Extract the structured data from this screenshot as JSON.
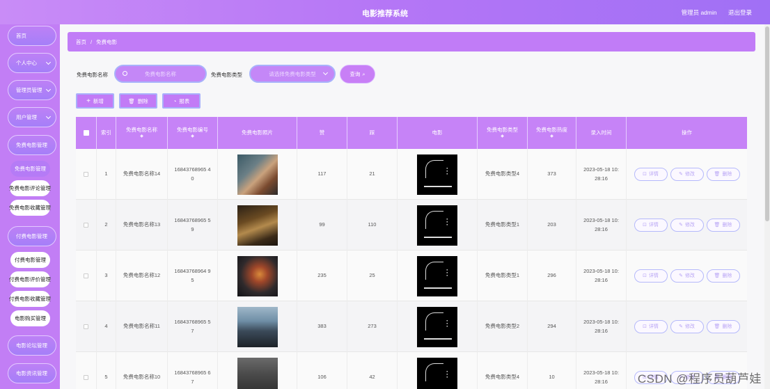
{
  "header": {
    "title": "电影推荐系统",
    "user_label": "管理员 admin",
    "logout": "退出登录"
  },
  "sidebar": {
    "items": [
      {
        "label": "首页"
      },
      {
        "label": "个人中心"
      },
      {
        "label": "管理员管理"
      },
      {
        "label": "用户管理"
      },
      {
        "label": "免费电影管理"
      },
      {
        "label": "免费电影管理"
      },
      {
        "label": "免费电影评论管理"
      },
      {
        "label": "免费电影收藏管理"
      },
      {
        "label": "付费电影管理"
      },
      {
        "label": "付费电影管理"
      },
      {
        "label": "付费电影评价管理"
      },
      {
        "label": "付费电影收藏管理"
      },
      {
        "label": "电影购买管理"
      },
      {
        "label": "电影论坛管理"
      },
      {
        "label": "电影资讯管理"
      }
    ]
  },
  "breadcrumb": {
    "home": "首页",
    "sep": "/",
    "current": "免费电影"
  },
  "search": {
    "name_label": "免费电影名称",
    "name_placeholder": "免费电影名称",
    "type_label": "免费电影类型",
    "type_placeholder": "请选择免费电影类型",
    "query": "查询"
  },
  "actions": {
    "add": "新增",
    "delete": "删除",
    "report": "报表"
  },
  "table": {
    "headers": [
      "索引",
      "免费电影名称",
      "免费电影编号",
      "免费电影照片",
      "赞",
      "踩",
      "电影",
      "免费电影类型",
      "免费电影热度",
      "录入时间",
      "操作"
    ],
    "ops": {
      "detail": "详情",
      "edit": "修改",
      "delete": "删除"
    },
    "rows": [
      {
        "index": "1",
        "name": "免费电影名称14",
        "code1": "16843768965 4",
        "code2": "0",
        "likes": "117",
        "dislikes": "21",
        "type": "免费电影类型4",
        "heat": "373",
        "date": "2023-05-18 10:",
        "time": "28:16"
      },
      {
        "index": "2",
        "name": "免费电影名称13",
        "code1": "16843768965 5",
        "code2": "9",
        "likes": "99",
        "dislikes": "110",
        "type": "免费电影类型1",
        "heat": "203",
        "date": "2023-05-18 10:",
        "time": "28:16"
      },
      {
        "index": "3",
        "name": "免费电影名称12",
        "code1": "16843768964 9",
        "code2": "5",
        "likes": "235",
        "dislikes": "25",
        "type": "免费电影类型1",
        "heat": "296",
        "date": "2023-05-18 10:",
        "time": "28:16"
      },
      {
        "index": "4",
        "name": "免费电影名称11",
        "code1": "16843768965 5",
        "code2": "7",
        "likes": "383",
        "dislikes": "273",
        "type": "免费电影类型2",
        "heat": "294",
        "date": "2023-05-18 10:",
        "time": "28:16"
      },
      {
        "index": "5",
        "name": "免费电影名称10",
        "code1": "16843768965 6",
        "code2": "7",
        "likes": "106",
        "dislikes": "42",
        "type": "免费电影类型4",
        "heat": "10",
        "date": "2023-05-18 10:",
        "time": "28:16"
      }
    ]
  },
  "watermark": "CSDN @程序员葫芦娃",
  "colors": {
    "accent": "#c27ef5",
    "header_start": "#c98cf7",
    "header_end": "#a070f5",
    "button_border": "#a9b0fb"
  }
}
